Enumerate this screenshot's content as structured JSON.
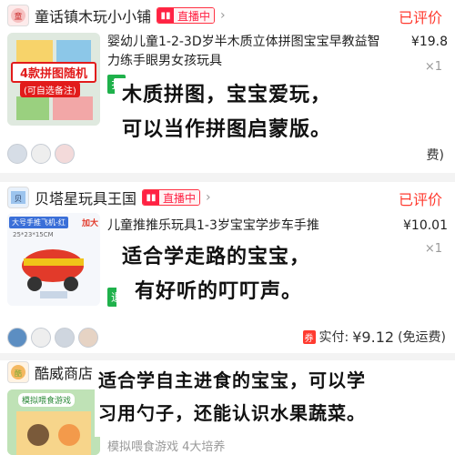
{
  "shops": [
    {
      "name": "童话镇木玩小小铺",
      "live_label": "直播中",
      "status": "已评价",
      "thumb_banner": "4款拼图随机",
      "thumb_note": "(可自选备注)",
      "title": "婴幼儿童1-2-3D岁半木质立体拼图宝宝早教益智力练手眼男女孩玩具",
      "price": "¥19.8",
      "qty": "×1",
      "overlay_line1": "木质拼图，宝宝爱玩，",
      "overlay_line2": "可以当作拼图启蒙版。",
      "tag_partial": "扌",
      "footer_partial": "费)"
    },
    {
      "name": "贝塔星玩具王国",
      "live_label": "直播中",
      "status": "已评价",
      "thumb_top_left": "大号手推飞机-红",
      "thumb_top_right": "加大",
      "thumb_size": "25*23*15CM",
      "title": "儿童推推乐玩具1-3岁宝宝学步车手推",
      "price": "¥10.01",
      "qty": "×1",
      "overlay_line1": "适合学走路的宝宝，",
      "overlay_line2": "有好听的叮叮声。",
      "tag_partial": "退",
      "paid_label": "实付:",
      "paid_amount": "¥9.12",
      "paid_note": "(免运费)",
      "coupon": "券"
    },
    {
      "name": "酷威商店",
      "thumb_label": "模拟喂食游戏",
      "title_partial": "模拟喂食游戏 4大培养",
      "overlay_line1": "适合学自主进食的宝宝，可以学",
      "overlay_line2": "习用勺子，还能认识水果蔬菜。"
    }
  ],
  "icons": {
    "chevron": "›",
    "live": "▮▮"
  },
  "colors": {
    "accent_red": "#ff3b30",
    "live_red": "#ff2244",
    "green": "#1fb14b"
  }
}
